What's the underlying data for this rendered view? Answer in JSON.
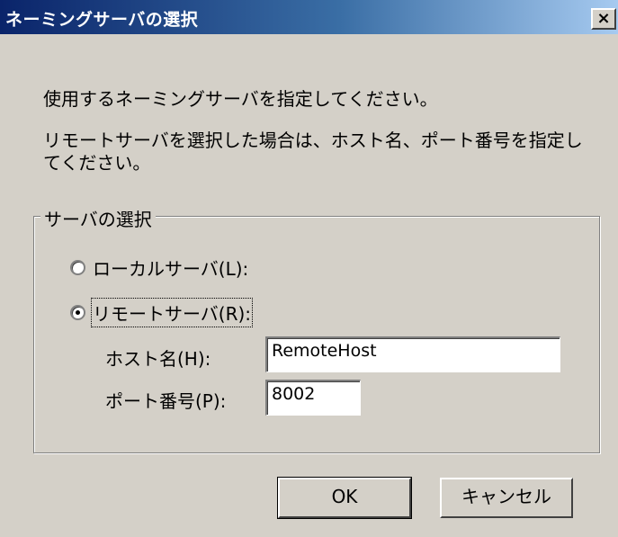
{
  "window": {
    "title": "ネーミングサーバの選択",
    "close_glyph": "×"
  },
  "message": {
    "line1": "使用するネーミングサーバを指定してください。",
    "line2": "リモートサーバを選択した場合は、ホスト名、ポート番号を指定してください。"
  },
  "server_group": {
    "label": "サーバの選択",
    "options": [
      {
        "label": "ローカルサーバ(L):",
        "selected": false
      },
      {
        "label": "リモートサーバ(R):",
        "selected": true
      }
    ]
  },
  "fields": {
    "host_label": "ホスト名(H):",
    "host_value": "RemoteHost",
    "port_label": "ポート番号(P):",
    "port_value": "8002"
  },
  "buttons": {
    "ok_label": "OK",
    "cancel_label": "キャンセル"
  }
}
